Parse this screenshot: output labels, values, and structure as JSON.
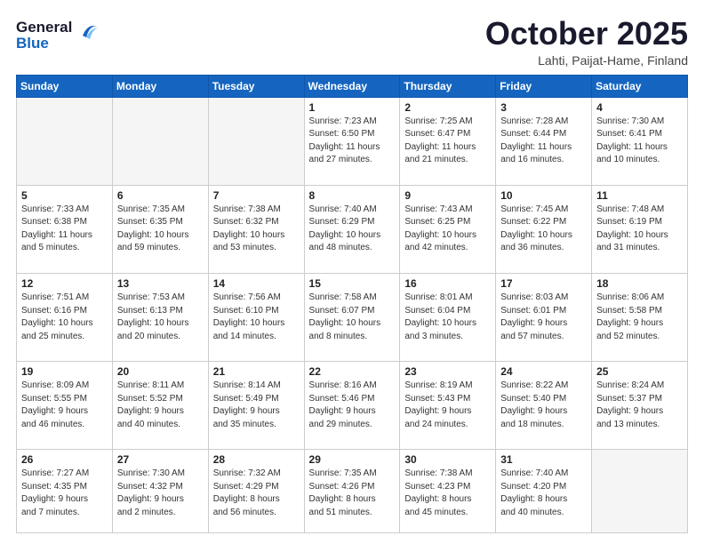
{
  "header": {
    "logo_line1": "General",
    "logo_line2": "Blue",
    "month": "October 2025",
    "location": "Lahti, Paijat-Hame, Finland"
  },
  "weekdays": [
    "Sunday",
    "Monday",
    "Tuesday",
    "Wednesday",
    "Thursday",
    "Friday",
    "Saturday"
  ],
  "weeks": [
    [
      {
        "day": "",
        "info": ""
      },
      {
        "day": "",
        "info": ""
      },
      {
        "day": "",
        "info": ""
      },
      {
        "day": "1",
        "info": "Sunrise: 7:23 AM\nSunset: 6:50 PM\nDaylight: 11 hours\nand 27 minutes."
      },
      {
        "day": "2",
        "info": "Sunrise: 7:25 AM\nSunset: 6:47 PM\nDaylight: 11 hours\nand 21 minutes."
      },
      {
        "day": "3",
        "info": "Sunrise: 7:28 AM\nSunset: 6:44 PM\nDaylight: 11 hours\nand 16 minutes."
      },
      {
        "day": "4",
        "info": "Sunrise: 7:30 AM\nSunset: 6:41 PM\nDaylight: 11 hours\nand 10 minutes."
      }
    ],
    [
      {
        "day": "5",
        "info": "Sunrise: 7:33 AM\nSunset: 6:38 PM\nDaylight: 11 hours\nand 5 minutes."
      },
      {
        "day": "6",
        "info": "Sunrise: 7:35 AM\nSunset: 6:35 PM\nDaylight: 10 hours\nand 59 minutes."
      },
      {
        "day": "7",
        "info": "Sunrise: 7:38 AM\nSunset: 6:32 PM\nDaylight: 10 hours\nand 53 minutes."
      },
      {
        "day": "8",
        "info": "Sunrise: 7:40 AM\nSunset: 6:29 PM\nDaylight: 10 hours\nand 48 minutes."
      },
      {
        "day": "9",
        "info": "Sunrise: 7:43 AM\nSunset: 6:25 PM\nDaylight: 10 hours\nand 42 minutes."
      },
      {
        "day": "10",
        "info": "Sunrise: 7:45 AM\nSunset: 6:22 PM\nDaylight: 10 hours\nand 36 minutes."
      },
      {
        "day": "11",
        "info": "Sunrise: 7:48 AM\nSunset: 6:19 PM\nDaylight: 10 hours\nand 31 minutes."
      }
    ],
    [
      {
        "day": "12",
        "info": "Sunrise: 7:51 AM\nSunset: 6:16 PM\nDaylight: 10 hours\nand 25 minutes."
      },
      {
        "day": "13",
        "info": "Sunrise: 7:53 AM\nSunset: 6:13 PM\nDaylight: 10 hours\nand 20 minutes."
      },
      {
        "day": "14",
        "info": "Sunrise: 7:56 AM\nSunset: 6:10 PM\nDaylight: 10 hours\nand 14 minutes."
      },
      {
        "day": "15",
        "info": "Sunrise: 7:58 AM\nSunset: 6:07 PM\nDaylight: 10 hours\nand 8 minutes."
      },
      {
        "day": "16",
        "info": "Sunrise: 8:01 AM\nSunset: 6:04 PM\nDaylight: 10 hours\nand 3 minutes."
      },
      {
        "day": "17",
        "info": "Sunrise: 8:03 AM\nSunset: 6:01 PM\nDaylight: 9 hours\nand 57 minutes."
      },
      {
        "day": "18",
        "info": "Sunrise: 8:06 AM\nSunset: 5:58 PM\nDaylight: 9 hours\nand 52 minutes."
      }
    ],
    [
      {
        "day": "19",
        "info": "Sunrise: 8:09 AM\nSunset: 5:55 PM\nDaylight: 9 hours\nand 46 minutes."
      },
      {
        "day": "20",
        "info": "Sunrise: 8:11 AM\nSunset: 5:52 PM\nDaylight: 9 hours\nand 40 minutes."
      },
      {
        "day": "21",
        "info": "Sunrise: 8:14 AM\nSunset: 5:49 PM\nDaylight: 9 hours\nand 35 minutes."
      },
      {
        "day": "22",
        "info": "Sunrise: 8:16 AM\nSunset: 5:46 PM\nDaylight: 9 hours\nand 29 minutes."
      },
      {
        "day": "23",
        "info": "Sunrise: 8:19 AM\nSunset: 5:43 PM\nDaylight: 9 hours\nand 24 minutes."
      },
      {
        "day": "24",
        "info": "Sunrise: 8:22 AM\nSunset: 5:40 PM\nDaylight: 9 hours\nand 18 minutes."
      },
      {
        "day": "25",
        "info": "Sunrise: 8:24 AM\nSunset: 5:37 PM\nDaylight: 9 hours\nand 13 minutes."
      }
    ],
    [
      {
        "day": "26",
        "info": "Sunrise: 7:27 AM\nSunset: 4:35 PM\nDaylight: 9 hours\nand 7 minutes."
      },
      {
        "day": "27",
        "info": "Sunrise: 7:30 AM\nSunset: 4:32 PM\nDaylight: 9 hours\nand 2 minutes."
      },
      {
        "day": "28",
        "info": "Sunrise: 7:32 AM\nSunset: 4:29 PM\nDaylight: 8 hours\nand 56 minutes."
      },
      {
        "day": "29",
        "info": "Sunrise: 7:35 AM\nSunset: 4:26 PM\nDaylight: 8 hours\nand 51 minutes."
      },
      {
        "day": "30",
        "info": "Sunrise: 7:38 AM\nSunset: 4:23 PM\nDaylight: 8 hours\nand 45 minutes."
      },
      {
        "day": "31",
        "info": "Sunrise: 7:40 AM\nSunset: 4:20 PM\nDaylight: 8 hours\nand 40 minutes."
      },
      {
        "day": "",
        "info": ""
      }
    ]
  ]
}
